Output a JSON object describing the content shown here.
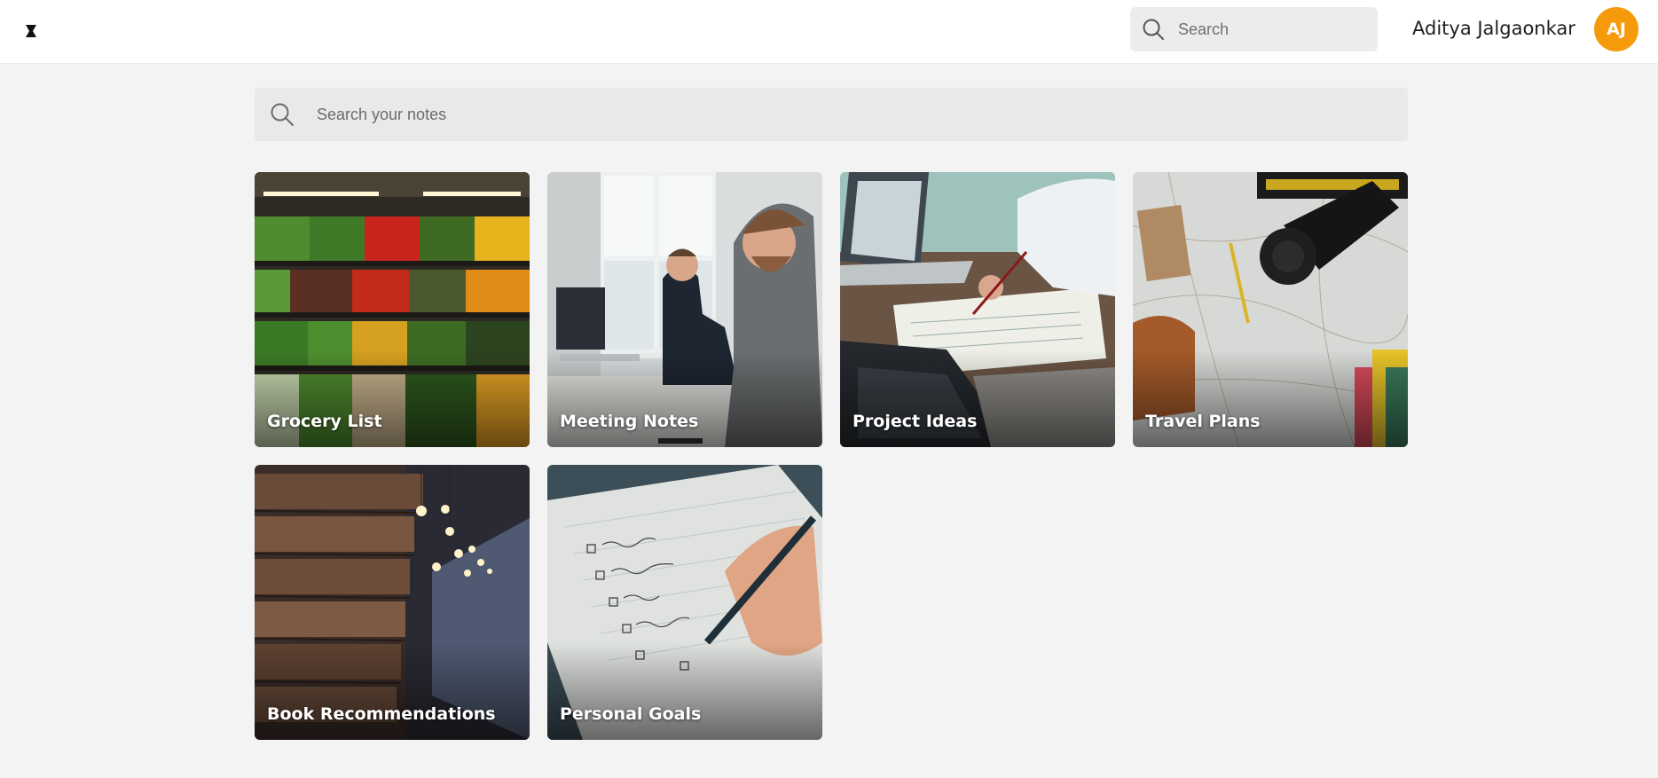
{
  "header": {
    "search_placeholder": "Search",
    "user_name": "Aditya Jalgaonkar",
    "avatar_initials": "AJ"
  },
  "notes_search": {
    "placeholder": "Search your notes"
  },
  "notes": [
    {
      "title": "Grocery List"
    },
    {
      "title": "Meeting Notes"
    },
    {
      "title": "Project Ideas"
    },
    {
      "title": "Travel Plans"
    },
    {
      "title": "Book Recommendations"
    },
    {
      "title": "Personal Goals"
    }
  ],
  "colors": {
    "accent": "#f59a0a",
    "background": "#f3f3f3",
    "topbar": "#ffffff"
  }
}
